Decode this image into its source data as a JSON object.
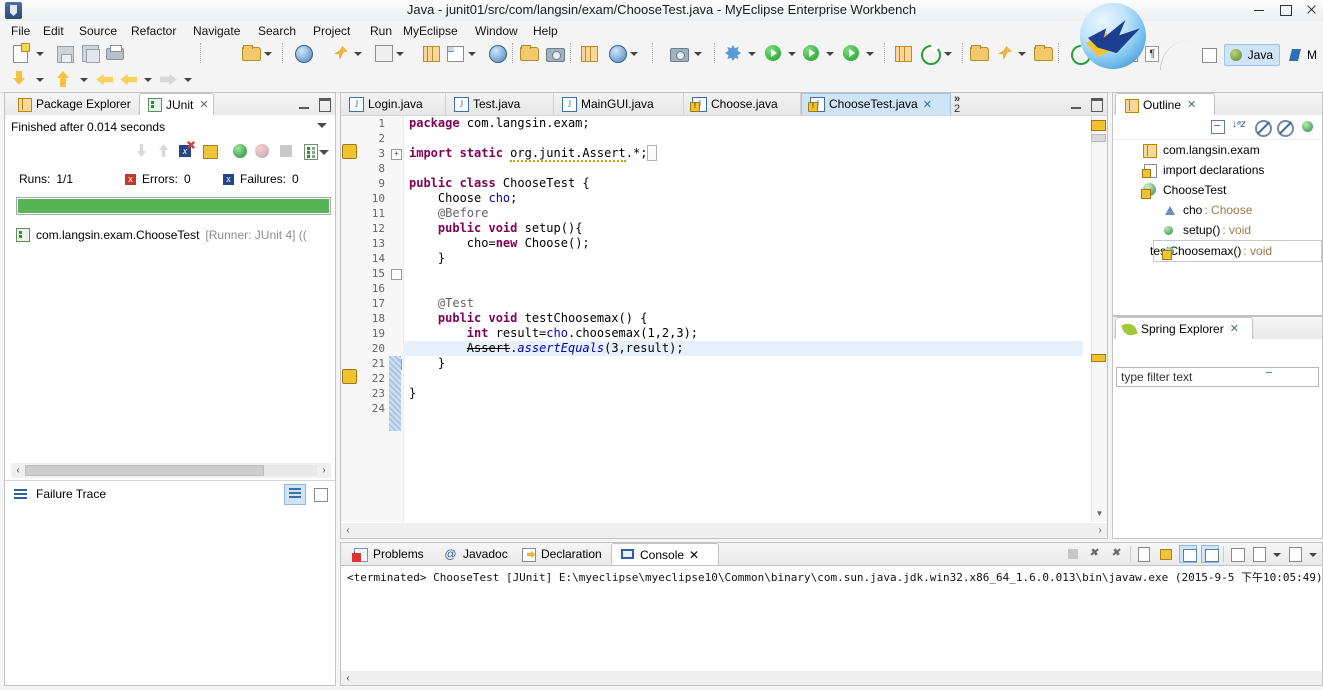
{
  "window": {
    "title": "Java - junit01/src/com/langsin/exam/ChooseTest.java - MyEclipse Enterprise Workbench",
    "minimize": "–",
    "maximize": "□",
    "close": "✕"
  },
  "menu": [
    "File",
    "Edit",
    "Source",
    "Refactor",
    "Navigate",
    "Search",
    "Project",
    "Run",
    "MyEclipse",
    "Window",
    "Help"
  ],
  "perspective": {
    "open_label": "Open Perspective",
    "items": [
      {
        "label": "Java",
        "active": true
      },
      {
        "label": "M",
        "active": false
      }
    ]
  },
  "junit": {
    "tabs": [
      {
        "label": "Package Explorer",
        "active": false
      },
      {
        "label": "JUnit",
        "active": true,
        "close": "✕"
      }
    ],
    "status": "Finished after 0.014 seconds",
    "counters": [
      {
        "label": "Runs:",
        "value": "1/1",
        "badge": null
      },
      {
        "label": "Errors:",
        "value": "0",
        "badge": "x"
      },
      {
        "label": "Failures:",
        "value": "0",
        "badge": "x"
      }
    ],
    "progress_color": "#56b356",
    "progress_percent": 100,
    "tree": [
      {
        "label": "com.langsin.exam.ChooseTest",
        "suffix": "[Runner: JUnit 4] (("
      }
    ],
    "failure_trace_label": "Failure Trace"
  },
  "editor": {
    "tabs": [
      {
        "label": "Login.java",
        "active": false,
        "warn": false
      },
      {
        "label": "Test.java",
        "active": false,
        "warn": false
      },
      {
        "label": "MainGUI.java",
        "active": false,
        "warn": false
      },
      {
        "label": "Choose.java",
        "active": false,
        "warn": true
      },
      {
        "label": "ChooseTest.java",
        "active": true,
        "warn": true,
        "close": "✕"
      }
    ],
    "overflow": {
      "chevron": "»",
      "count": "2"
    },
    "lines": [
      {
        "num": "1",
        "text": "package com.langsin.exam;"
      },
      {
        "num": "2",
        "text": ""
      },
      {
        "num": "3",
        "text": "import static org.junit.Assert.*;",
        "fold": "+"
      },
      {
        "num": "8",
        "text": ""
      },
      {
        "num": "9",
        "text": "public class ChooseTest {"
      },
      {
        "num": "10",
        "text": "    Choose cho;"
      },
      {
        "num": "11",
        "text": "    @Before",
        "fold": "-"
      },
      {
        "num": "12",
        "text": "    public void setup(){"
      },
      {
        "num": "13",
        "text": "        cho=new Choose();"
      },
      {
        "num": "14",
        "text": "    }"
      },
      {
        "num": "15",
        "text": ""
      },
      {
        "num": "16",
        "text": ""
      },
      {
        "num": "17",
        "text": "    @Test",
        "fold": "-"
      },
      {
        "num": "18",
        "text": "    public void testChoosemax() {"
      },
      {
        "num": "19",
        "text": "        int result=cho.choosemax(1,2,3);"
      },
      {
        "num": "20",
        "text": "        Assert.assertEquals(3,result);",
        "highlight": true
      },
      {
        "num": "21",
        "text": "    }"
      },
      {
        "num": "22",
        "text": ""
      },
      {
        "num": "23",
        "text": "}"
      },
      {
        "num": "24",
        "text": ""
      }
    ]
  },
  "outline": {
    "tab": "Outline",
    "close": "✕",
    "items": [
      {
        "label": "com.langsin.exam",
        "type": "package",
        "indent": 0
      },
      {
        "label": "import declarations",
        "type": "imports",
        "indent": 0
      },
      {
        "label": "ChooseTest",
        "type": "class",
        "indent": 0
      },
      {
        "label": "cho : Choose",
        "name": "cho",
        "type_text": " : Choose",
        "type": "field",
        "indent": 1
      },
      {
        "label": "setup() : void",
        "name": "setup()",
        "type_text": " : void",
        "type": "method",
        "indent": 1
      },
      {
        "label": "testChoosemax() : void",
        "name": "testChoosemax()",
        "type_text": " : void",
        "type": "method-warn",
        "indent": 1,
        "selected": true
      }
    ]
  },
  "spring": {
    "tab": "Spring Explorer",
    "close": "✕",
    "filter_placeholder": "type filter text",
    "filter_value": "type filter text"
  },
  "console": {
    "tabs": [
      {
        "label": "Problems",
        "active": false,
        "icon": "problems-icon"
      },
      {
        "label": "Javadoc",
        "active": false,
        "icon": "javadoc-icon"
      },
      {
        "label": "Declaration",
        "active": false,
        "icon": "declaration-icon"
      },
      {
        "label": "Console",
        "active": true,
        "icon": "console-icon",
        "close": "✕"
      }
    ],
    "output": "<terminated> ChooseTest [JUnit] E:\\myeclipse\\myeclipse10\\Common\\binary\\com.sun.java.jdk.win32.x86_64_1.6.0.013\\bin\\javaw.exe (2015-9-5 下午10:05:49)"
  },
  "colors": {
    "accent": "#cfe4f7",
    "progress_green": "#56b356",
    "keyword": "#7f0055",
    "annotation": "#646464",
    "field": "#0000c0",
    "error_red": "#c0392b",
    "failure_blue": "#24458c"
  }
}
